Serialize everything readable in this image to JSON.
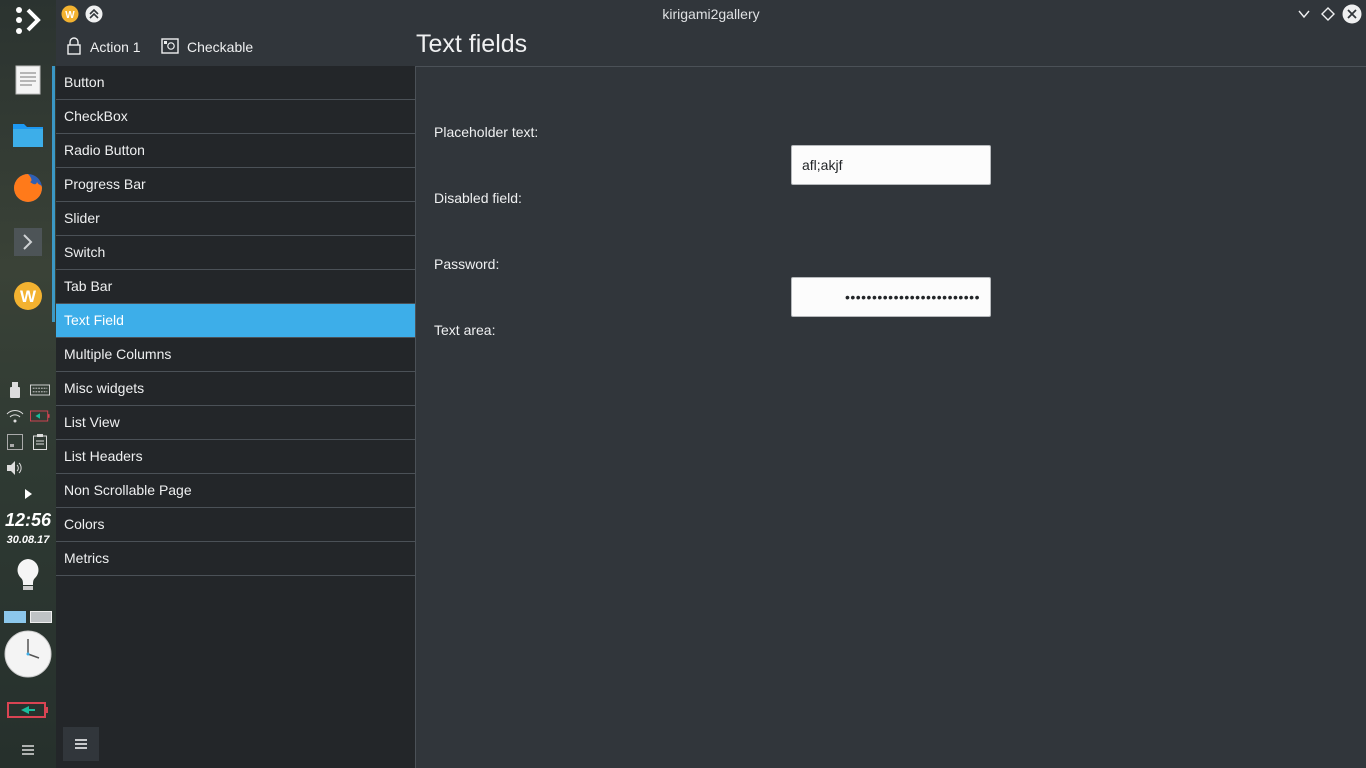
{
  "window": {
    "title": "kirigami2gallery"
  },
  "toolbar": {
    "actions": [
      {
        "label": "Action 1",
        "icon": "lock-icon"
      },
      {
        "label": "Checkable",
        "icon": "checkable-icon"
      }
    ]
  },
  "page": {
    "title": "Text fields"
  },
  "sidebar": {
    "items": [
      {
        "label": "Button"
      },
      {
        "label": "CheckBox"
      },
      {
        "label": "Radio Button"
      },
      {
        "label": "Progress Bar"
      },
      {
        "label": "Slider"
      },
      {
        "label": "Switch"
      },
      {
        "label": "Tab Bar"
      },
      {
        "label": "Text Field",
        "selected": true
      },
      {
        "label": "Multiple Columns"
      },
      {
        "label": "Misc widgets"
      },
      {
        "label": "List View"
      },
      {
        "label": "List Headers"
      },
      {
        "label": "Non Scrollable Page"
      },
      {
        "label": "Colors"
      },
      {
        "label": "Metrics"
      }
    ],
    "drawer_icon": "hamburger-menu-icon"
  },
  "form": {
    "placeholder_label": "Placeholder text:",
    "placeholder_value": "afl;akjf",
    "disabled_label": "Disabled field:",
    "password_label": "Password:",
    "password_value": "•••••••••••••••••••••••••",
    "textarea_label": "Text area:"
  },
  "dock": {
    "time": "12:56",
    "date": "30.08.17"
  },
  "colors": {
    "accent": "#3daee9",
    "background": "#31363b",
    "sidebar": "#232629"
  }
}
